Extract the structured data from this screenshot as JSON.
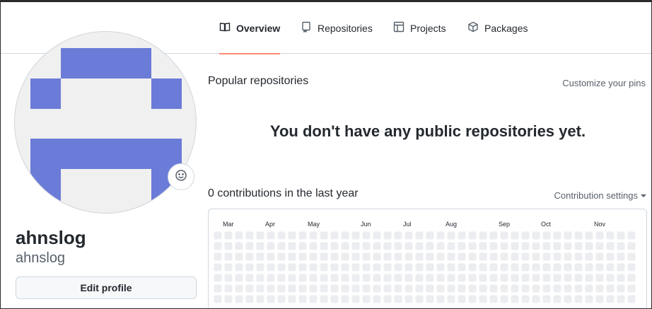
{
  "nav": {
    "tabs": [
      {
        "label": "Overview",
        "icon": "book-icon",
        "active": true
      },
      {
        "label": "Repositories",
        "icon": "repo-icon",
        "active": false
      },
      {
        "label": "Projects",
        "icon": "table-icon",
        "active": false
      },
      {
        "label": "Packages",
        "icon": "package-icon",
        "active": false
      }
    ]
  },
  "profile": {
    "name": "ahnslog",
    "login": "ahnslog",
    "edit_label": "Edit profile",
    "avatar_color": "#6b7bd8",
    "avatar_bg": "#f0f0f0"
  },
  "pinned": {
    "title": "Popular repositories",
    "customize_label": "Customize your pins",
    "empty_message": "You don't have any public repositories yet."
  },
  "contributions": {
    "title": "0 contributions in the last year",
    "settings_label": "Contribution settings",
    "months": [
      "Mar",
      "Apr",
      "May",
      "Jun",
      "Jul",
      "Aug",
      "Sep",
      "Oct",
      "Nov"
    ],
    "cell_color": "#ebedf0"
  },
  "colors": {
    "accent_underline": "#fd8c73",
    "border": "#d0d7de",
    "muted_text": "#57606a"
  }
}
